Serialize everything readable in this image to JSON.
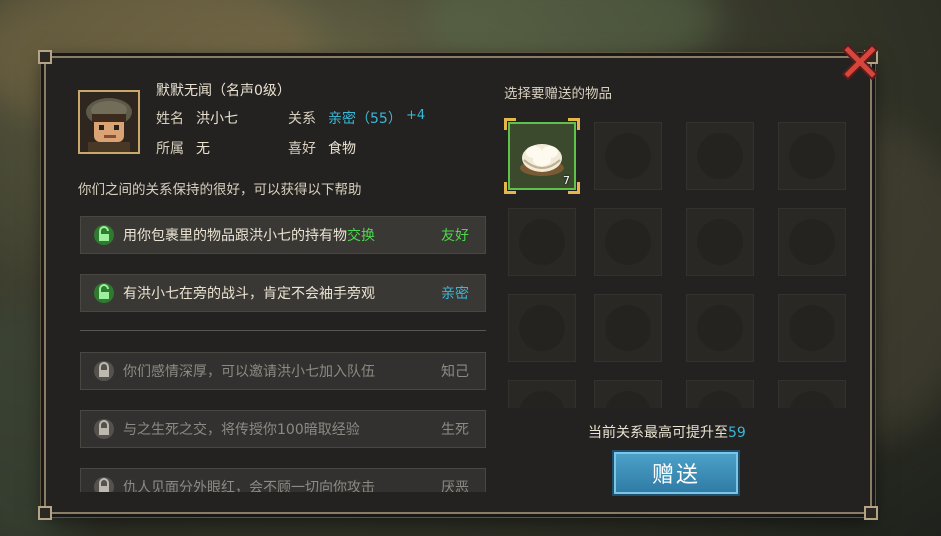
{
  "npc": {
    "title": "默默无闻（名声0级）",
    "name_label": "姓名",
    "name_value": "洪小七",
    "relation_label": "关系",
    "relation_value": "亲密（55）",
    "relation_bonus": "+4",
    "faction_label": "所属",
    "faction_value": "无",
    "likes_label": "喜好",
    "likes_value": "食物"
  },
  "help_intro": "你们之间的关系保持的很好，可以获得以下帮助",
  "benefits": [
    {
      "text_before": "用你包裹里的物品跟洪小七的持有物",
      "text_highlight": "交换",
      "tag": "友好",
      "tag_color": "#4cd84c",
      "unlocked": true
    },
    {
      "text_before": "有洪小七在旁的战斗，肯定不会袖手旁观",
      "text_highlight": "",
      "tag": "亲密",
      "tag_color": "#39b8d8",
      "unlocked": true
    },
    {
      "text_before": "你们感情深厚，可以邀请洪小七加入队伍",
      "text_highlight": "",
      "tag": "知己",
      "unlocked": false
    },
    {
      "text_before": "与之生死之交，将传授你100暗取经验",
      "text_highlight": "",
      "tag": "生死",
      "unlocked": false
    },
    {
      "text_before": "仇人见面分外眼红，会不顾一切向你攻击",
      "text_highlight": "",
      "tag": "厌恶",
      "unlocked": false
    }
  ],
  "gift": {
    "header": "选择要赠送的物品",
    "items": [
      {
        "icon": "steamed-bun-icon",
        "count": "7",
        "selected": true
      }
    ],
    "max_text": "当前关系最高可提升至",
    "max_value": "59",
    "button_label": "赠送"
  },
  "colors": {
    "accent_green": "#4cd84c",
    "accent_cyan": "#39b8d8",
    "button_blue": "#3b8fbb",
    "frame_gold": "#c9a86a"
  }
}
